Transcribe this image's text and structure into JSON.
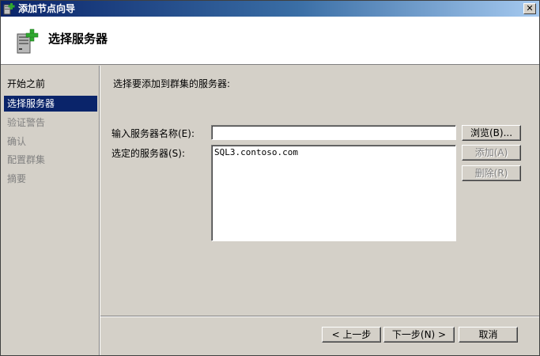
{
  "window": {
    "title": "添加节点向导",
    "close_glyph": "✕"
  },
  "header": {
    "title": "选择服务器"
  },
  "nav": {
    "items": [
      {
        "label": "开始之前",
        "state": "normal"
      },
      {
        "label": "选择服务器",
        "state": "active"
      },
      {
        "label": "验证警告",
        "state": "disabled"
      },
      {
        "label": "确认",
        "state": "disabled"
      },
      {
        "label": "配置群集",
        "state": "disabled"
      },
      {
        "label": "摘要",
        "state": "disabled"
      }
    ]
  },
  "content": {
    "prompt": "选择要添加到群集的服务器:",
    "server_name_label": "输入服务器名称(E):",
    "server_name_value": "",
    "selected_servers_label": "选定的服务器(S):",
    "selected_servers": [
      "SQL3.contoso.com"
    ],
    "browse_label": "浏览(B)...",
    "add_label": "添加(A)",
    "remove_label": "删除(R)"
  },
  "footer": {
    "back_label": "< 上一步",
    "next_label": "下一步(N) >",
    "cancel_label": "取消"
  },
  "colors": {
    "nav_active_bg": "#0a246a",
    "titlebar_start": "#0a246a",
    "dialog_bg": "#d4d0c8"
  }
}
